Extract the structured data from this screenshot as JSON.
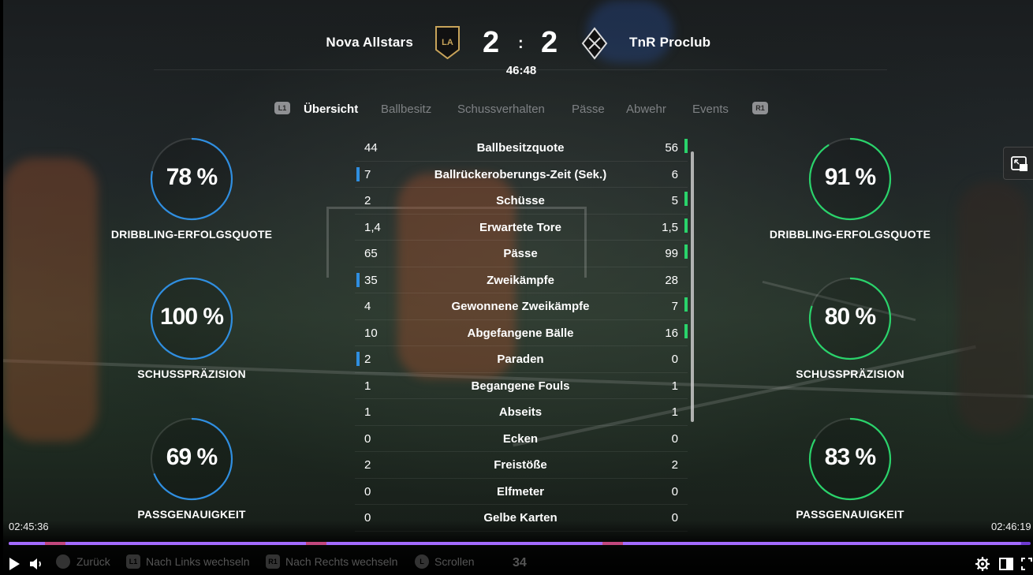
{
  "scoreboard": {
    "home_team": "Nova Allstars",
    "away_team": "TnR Proclub",
    "home_score": "2",
    "away_score": "2",
    "separator": ":",
    "match_time": "46:48",
    "home_color": "#2f8ee0",
    "away_color": "#2ad36b"
  },
  "tabs": {
    "left_shoulder": "L1",
    "right_shoulder": "R1",
    "items": [
      "Übersicht",
      "Ballbesitz",
      "Schussverhalten",
      "Pässe",
      "Abwehr",
      "Events"
    ],
    "active": "Übersicht"
  },
  "home_gauges": [
    {
      "value": "78 %",
      "label": "DRIBBLING-ERFOLGSQUOTE",
      "fraction": 0.78
    },
    {
      "value": "100 %",
      "label": "SCHUSSPRÄZISION",
      "fraction": 1.0
    },
    {
      "value": "69 %",
      "label": "PASSGENAUIGKEIT",
      "fraction": 0.69
    }
  ],
  "away_gauges": [
    {
      "value": "91 %",
      "label": "DRIBBLING-ERFOLGSQUOTE",
      "fraction": 0.91
    },
    {
      "value": "80 %",
      "label": "SCHUSSPRÄZISION",
      "fraction": 0.8
    },
    {
      "value": "83 %",
      "label": "PASSGENAUIGKEIT",
      "fraction": 0.83
    }
  ],
  "stats": [
    {
      "home": "44",
      "name": "Ballbesitzquote",
      "away": "56",
      "leader": "away"
    },
    {
      "home": "7",
      "name": "Ballrückeroberungs-Zeit (Sek.)",
      "away": "6",
      "leader": "home"
    },
    {
      "home": "2",
      "name": "Schüsse",
      "away": "5",
      "leader": "away"
    },
    {
      "home": "1,4",
      "name": "Erwartete Tore",
      "away": "1,5",
      "leader": "away"
    },
    {
      "home": "65",
      "name": "Pässe",
      "away": "99",
      "leader": "away"
    },
    {
      "home": "35",
      "name": "Zweikämpfe",
      "away": "28",
      "leader": "home"
    },
    {
      "home": "4",
      "name": "Gewonnene Zweikämpfe",
      "away": "7",
      "leader": "away"
    },
    {
      "home": "10",
      "name": "Abgefangene Bälle",
      "away": "16",
      "leader": "away"
    },
    {
      "home": "2",
      "name": "Paraden",
      "away": "0",
      "leader": "home"
    },
    {
      "home": "1",
      "name": "Begangene Fouls",
      "away": "1",
      "leader": "none"
    },
    {
      "home": "1",
      "name": "Abseits",
      "away": "1",
      "leader": "none"
    },
    {
      "home": "0",
      "name": "Ecken",
      "away": "0",
      "leader": "none"
    },
    {
      "home": "2",
      "name": "Freistöße",
      "away": "2",
      "leader": "none"
    },
    {
      "home": "0",
      "name": "Elfmeter",
      "away": "0",
      "leader": "none"
    },
    {
      "home": "0",
      "name": "Gelbe Karten",
      "away": "0",
      "leader": "none"
    }
  ],
  "player": {
    "current_time": "02:45:36",
    "end_time": "02:46:19",
    "progress": 0.991,
    "hints": {
      "back": "Zurück",
      "switch_left": "Nach Links wechseln",
      "switch_right": "Nach Rechts wechseln",
      "scroll": "Scrollen",
      "l1": "L1",
      "r1": "R1",
      "l": "L"
    },
    "counter": "34",
    "icons": [
      "play-icon",
      "volume-icon",
      "settings-icon",
      "theater-mode-icon",
      "fullscreen-icon",
      "picture-in-picture-icon"
    ]
  }
}
